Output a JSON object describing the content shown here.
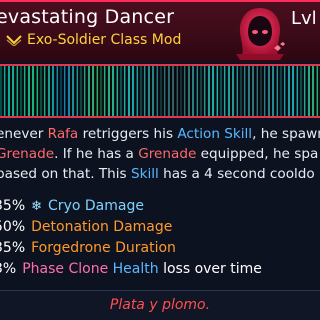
{
  "item": {
    "name": "evastating Dancer",
    "type": "Exo-Soldier Class Mod",
    "level_label": "Lvl"
  },
  "description": {
    "line1": [
      {
        "text": "enever ",
        "style": "plain"
      },
      {
        "text": "Rafa",
        "style": "red"
      },
      {
        "text": " retriggers his ",
        "style": "plain"
      },
      {
        "text": "Action Skill",
        "style": "blue"
      },
      {
        "text": ", he spawn",
        "style": "plain"
      }
    ],
    "line2": [
      {
        "text": " ",
        "style": "plain"
      },
      {
        "text": "Grenade",
        "style": "red"
      },
      {
        "text": ". If he has a ",
        "style": "plain"
      },
      {
        "text": "Grenade",
        "style": "red"
      },
      {
        "text": " equipped, he spa",
        "style": "plain"
      }
    ],
    "line3": [
      {
        "text": " based on that. This ",
        "style": "plain"
      },
      {
        "text": "Skill",
        "style": "blue"
      },
      {
        "text": " has a 4 second cooldo",
        "style": "plain"
      }
    ]
  },
  "stats": [
    {
      "value": "35%",
      "icon": "snowflake-icon",
      "label": "Cryo Damage",
      "color": "#7fd4ff"
    },
    {
      "value": "50%",
      "label": "Detonation Damage",
      "color": "#ff9a2a"
    },
    {
      "value": "35%",
      "label": "Forgedrone Duration",
      "color": "#ff9a2a"
    },
    {
      "value": "3%",
      "label": "Phase Clone",
      "label_b": "Health",
      "label_c": "loss over time",
      "color": "#ff6fb0"
    }
  ],
  "flavor_text": "Plata y plomo.",
  "colors": {
    "accent_red": "#ff2b5a",
    "gold": "#ffd23a",
    "skill_blue": "#5ab8ff",
    "flavor_red": "#ff4f4f"
  }
}
